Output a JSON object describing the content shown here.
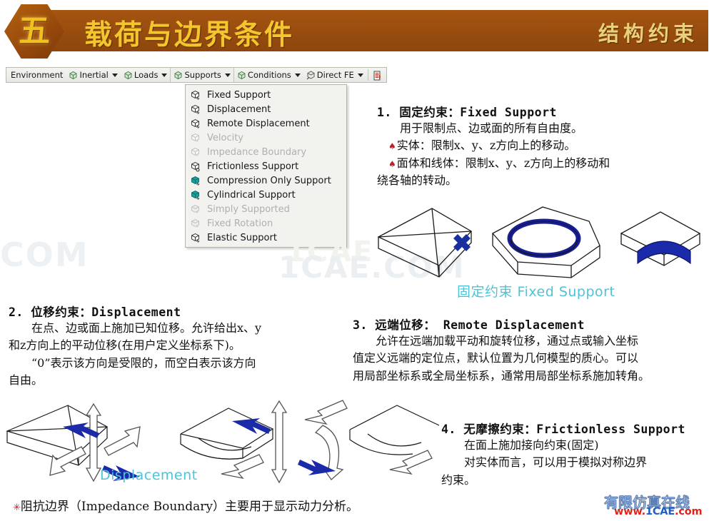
{
  "header": {
    "chapter_number": "五",
    "title": "载荷与边界条件",
    "subtitle": "结构约束"
  },
  "toolbar": {
    "items": [
      {
        "label": "Environment",
        "icon": null,
        "caret": false,
        "active": false
      },
      {
        "label": "Inertial",
        "icon": "cube-icon",
        "caret": true,
        "active": false
      },
      {
        "label": "Loads",
        "icon": "cube-icon",
        "caret": true,
        "active": false
      },
      {
        "label": "Supports",
        "icon": "cube-icon",
        "caret": true,
        "active": true
      },
      {
        "label": "Conditions",
        "icon": "cube-icon",
        "caret": true,
        "active": false
      },
      {
        "label": "Direct FE",
        "icon": "cube-icon",
        "caret": true,
        "active": false
      }
    ],
    "end_icon": "worksheet-icon"
  },
  "dropdown": {
    "open_from": "Supports",
    "items": [
      {
        "label": "Fixed Support",
        "enabled": true,
        "icon": "support-cube-icon"
      },
      {
        "label": "Displacement",
        "enabled": true,
        "icon": "support-cube-icon"
      },
      {
        "label": "Remote Displacement",
        "enabled": true,
        "icon": "support-cube-icon"
      },
      {
        "label": "Velocity",
        "enabled": false,
        "icon": "support-cube-icon"
      },
      {
        "label": "Impedance Boundary",
        "enabled": false,
        "icon": "support-cube-icon"
      },
      {
        "label": "Frictionless Support",
        "enabled": true,
        "icon": "support-cube-icon"
      },
      {
        "label": "Compression Only Support",
        "enabled": true,
        "icon": "teal-cube-icon"
      },
      {
        "label": "Cylindrical Support",
        "enabled": true,
        "icon": "teal-cube-icon"
      },
      {
        "label": "Simply Supported",
        "enabled": false,
        "icon": "support-cube-icon"
      },
      {
        "label": "Fixed Rotation",
        "enabled": false,
        "icon": "support-cube-icon"
      },
      {
        "label": "Elastic Support",
        "enabled": true,
        "icon": "support-cube-icon"
      }
    ]
  },
  "sections": {
    "s1": {
      "heading": "1. 固定约束：Fixed  Support",
      "l1": "用于限制点、边或面的所有自由度。",
      "l2": "实体：限制x、y、z方向上的移动。",
      "l3": "面体和线体：限制x、y、z方向上的移动和",
      "l4": "绕各轴的转动。"
    },
    "s2": {
      "heading": "2. 位移约束：Displacement",
      "l1": "在点、边或面上施加已知位移。允许给出x、y",
      "l2": "和z方向上的平动位移(在用户定义坐标系下)。",
      "l3": "“0”表示该方向是受限的，而空白表示该方向",
      "l4": "自由。"
    },
    "s3": {
      "heading": "3. 远端位移： Remote Displacement",
      "l1": "允许在远端加载平动和旋转位移，通过点或输入坐标",
      "l2": "值定义远端的定位点，默认位置为几何模型的质心。可以",
      "l3": "用局部坐标系或全局坐标系，通常用局部坐标系施加转角。"
    },
    "s4": {
      "heading": "4. 无摩擦约束：Frictionless  Support",
      "l1": "在面上施加接向约束(固定)",
      "l2": "对实体而言，可以用于模拟对称边界",
      "l3": "约束。"
    },
    "s5": {
      "text": "阻抗边界（Impedance Boundary）主要用于显示动力分析。"
    }
  },
  "captions": {
    "fixed_support": "固定约束 Fixed Support",
    "displacement": "Displacement"
  },
  "watermarks": {
    "center": "1CAE.COM",
    "left": "COM",
    "right": "1CAE"
  },
  "logo": {
    "cn": "有限仿真在线",
    "url_prefix": "www.",
    "url_brand": "1CAE",
    "url_suffix": ".com"
  },
  "colors": {
    "header_brown": "#9a4e0f",
    "header_gold": "#f3c52e",
    "caption_cyan": "#4fc3d6",
    "arrow_blue": "#1f2f9e",
    "accent_red": "#b7222c"
  }
}
